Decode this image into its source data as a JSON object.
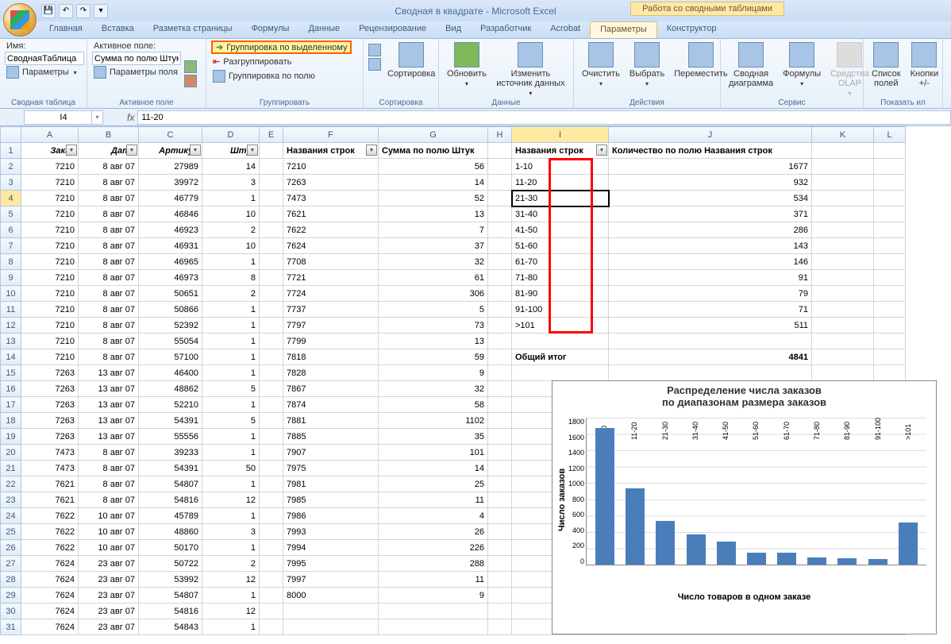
{
  "window": {
    "title": "Сводная в квадрате - Microsoft Excel",
    "context_tab": "Работа со сводными таблицами"
  },
  "tabs": {
    "items": [
      "Главная",
      "Вставка",
      "Разметка страницы",
      "Формулы",
      "Данные",
      "Рецензирование",
      "Вид",
      "Разработчик",
      "Acrobat",
      "Параметры",
      "Конструктор"
    ],
    "active": 9
  },
  "ribbon": {
    "g1": {
      "lbl_name": "Имя:",
      "val_name": "СводнаяТаблица",
      "params": "Параметры",
      "group": "Сводная таблица"
    },
    "g2": {
      "lbl_active": "Активное поле:",
      "val_active": "Сумма по полю Штук",
      "field_params": "Параметры поля",
      "group": "Активное поле"
    },
    "g3": {
      "b1": "Группировка по выделенному",
      "b2": "Разгруппировать",
      "b3": "Группировка по полю",
      "group": "Группировать"
    },
    "g4": {
      "big": "Сортировка",
      "group": "Сортировка"
    },
    "g5": {
      "b1": "Обновить",
      "b2": "Изменить источник данных",
      "group": "Данные"
    },
    "g6": {
      "b1": "Очистить",
      "b2": "Выбрать",
      "b3": "Переместить",
      "group": "Действия"
    },
    "g7": {
      "b1": "Сводная диаграмма",
      "b2": "Формулы",
      "b3": "Средства OLAP",
      "group": "Сервис"
    },
    "g8": {
      "b1": "Список полей",
      "b2": "Кнопки +/-",
      "group": "Показать ил"
    }
  },
  "namebox": "I4",
  "formula": "11-20",
  "cols": [
    "A",
    "B",
    "C",
    "D",
    "E",
    "F",
    "G",
    "H",
    "I",
    "J",
    "K",
    "L"
  ],
  "headers_main": {
    "A": "Заказ",
    "B": "Дата",
    "C": "Артикул",
    "D": "Штук"
  },
  "pivot1": {
    "rowlabel": "Названия строк",
    "vallabel": "Сумма по полю Штук"
  },
  "pivot2": {
    "rowlabel": "Названия строк",
    "vallabel": "Количество по полю Названия строк",
    "total_label": "Общий итог",
    "total_val": 4841
  },
  "data_rows": [
    {
      "A": 7210,
      "B": "8 авг 07",
      "C": 27989,
      "D": 14,
      "F": "7210",
      "G": 56,
      "I": "1-10",
      "J": 1677
    },
    {
      "A": 7210,
      "B": "8 авг 07",
      "C": 39972,
      "D": 3,
      "F": "7263",
      "G": 14,
      "I": "11-20",
      "J": 932
    },
    {
      "A": 7210,
      "B": "8 авг 07",
      "C": 46779,
      "D": 1,
      "F": "7473",
      "G": 52,
      "I": "21-30",
      "J": 534
    },
    {
      "A": 7210,
      "B": "8 авг 07",
      "C": 46846,
      "D": 10,
      "F": "7621",
      "G": 13,
      "I": "31-40",
      "J": 371
    },
    {
      "A": 7210,
      "B": "8 авг 07",
      "C": 46923,
      "D": 2,
      "F": "7622",
      "G": 7,
      "I": "41-50",
      "J": 286
    },
    {
      "A": 7210,
      "B": "8 авг 07",
      "C": 46931,
      "D": 10,
      "F": "7624",
      "G": 37,
      "I": "51-60",
      "J": 143
    },
    {
      "A": 7210,
      "B": "8 авг 07",
      "C": 46965,
      "D": 1,
      "F": "7708",
      "G": 32,
      "I": "61-70",
      "J": 146
    },
    {
      "A": 7210,
      "B": "8 авг 07",
      "C": 46973,
      "D": 8,
      "F": "7721",
      "G": 61,
      "I": "71-80",
      "J": 91
    },
    {
      "A": 7210,
      "B": "8 авг 07",
      "C": 50651,
      "D": 2,
      "F": "7724",
      "G": 306,
      "I": "81-90",
      "J": 79
    },
    {
      "A": 7210,
      "B": "8 авг 07",
      "C": 50866,
      "D": 1,
      "F": "7737",
      "G": 5,
      "I": "91-100",
      "J": 71
    },
    {
      "A": 7210,
      "B": "8 авг 07",
      "C": 52392,
      "D": 1,
      "F": "7797",
      "G": 73,
      "I": ">101",
      "J": 511
    },
    {
      "A": 7210,
      "B": "8 авг 07",
      "C": 55054,
      "D": 1,
      "F": "7799",
      "G": 13
    },
    {
      "A": 7210,
      "B": "8 авг 07",
      "C": 57100,
      "D": 1,
      "F": "7818",
      "G": 59
    },
    {
      "A": 7263,
      "B": "13 авг 07",
      "C": 46400,
      "D": 1,
      "F": "7828",
      "G": 9
    },
    {
      "A": 7263,
      "B": "13 авг 07",
      "C": 48862,
      "D": 5,
      "F": "7867",
      "G": 32
    },
    {
      "A": 7263,
      "B": "13 авг 07",
      "C": 52210,
      "D": 1,
      "F": "7874",
      "G": 58
    },
    {
      "A": 7263,
      "B": "13 авг 07",
      "C": 54391,
      "D": 5,
      "F": "7881",
      "G": 1102
    },
    {
      "A": 7263,
      "B": "13 авг 07",
      "C": 55556,
      "D": 1,
      "F": "7885",
      "G": 35
    },
    {
      "A": 7473,
      "B": "8 авг 07",
      "C": 39233,
      "D": 1,
      "F": "7907",
      "G": 101
    },
    {
      "A": 7473,
      "B": "8 авг 07",
      "C": 54391,
      "D": 50,
      "F": "7975",
      "G": 14
    },
    {
      "A": 7621,
      "B": "8 авг 07",
      "C": 54807,
      "D": 1,
      "F": "7981",
      "G": 25
    },
    {
      "A": 7621,
      "B": "8 авг 07",
      "C": 54816,
      "D": 12,
      "F": "7985",
      "G": 11
    },
    {
      "A": 7622,
      "B": "10 авг 07",
      "C": 45789,
      "D": 1,
      "F": "7986",
      "G": 4
    },
    {
      "A": 7622,
      "B": "10 авг 07",
      "C": 48860,
      "D": 3,
      "F": "7993",
      "G": 26
    },
    {
      "A": 7622,
      "B": "10 авг 07",
      "C": 50170,
      "D": 1,
      "F": "7994",
      "G": 226
    },
    {
      "A": 7624,
      "B": "23 авг 07",
      "C": 50722,
      "D": 2,
      "F": "7995",
      "G": 288
    },
    {
      "A": 7624,
      "B": "23 авг 07",
      "C": 53992,
      "D": 12,
      "F": "7997",
      "G": 11
    },
    {
      "A": 7624,
      "B": "23 авг 07",
      "C": 54807,
      "D": 1,
      "F": "8000",
      "G": 9
    },
    {
      "A": 7624,
      "B": "23 авг 07",
      "C": 54816,
      "D": 12,
      "F": "",
      "G": ""
    },
    {
      "A": 7624,
      "B": "23 авг 07",
      "C": 54843,
      "D": 1,
      "F": "",
      "G": ""
    }
  ],
  "chart_data": {
    "type": "bar",
    "title": "Распределение числа заказов по диапазонам размера заказов",
    "categories": [
      "1-10",
      "11-20",
      "21-30",
      "31-40",
      "41-50",
      "51-60",
      "61-70",
      "71-80",
      "81-90",
      "91-100",
      ">101"
    ],
    "values": [
      1677,
      932,
      534,
      371,
      286,
      143,
      146,
      91,
      79,
      71,
      511
    ],
    "ylabel": "Число заказов",
    "xlabel": "Число товаров в одном заказе",
    "ylim": [
      0,
      1800
    ],
    "yticks": [
      0,
      200,
      400,
      600,
      800,
      1000,
      1200,
      1400,
      1600,
      1800
    ]
  }
}
